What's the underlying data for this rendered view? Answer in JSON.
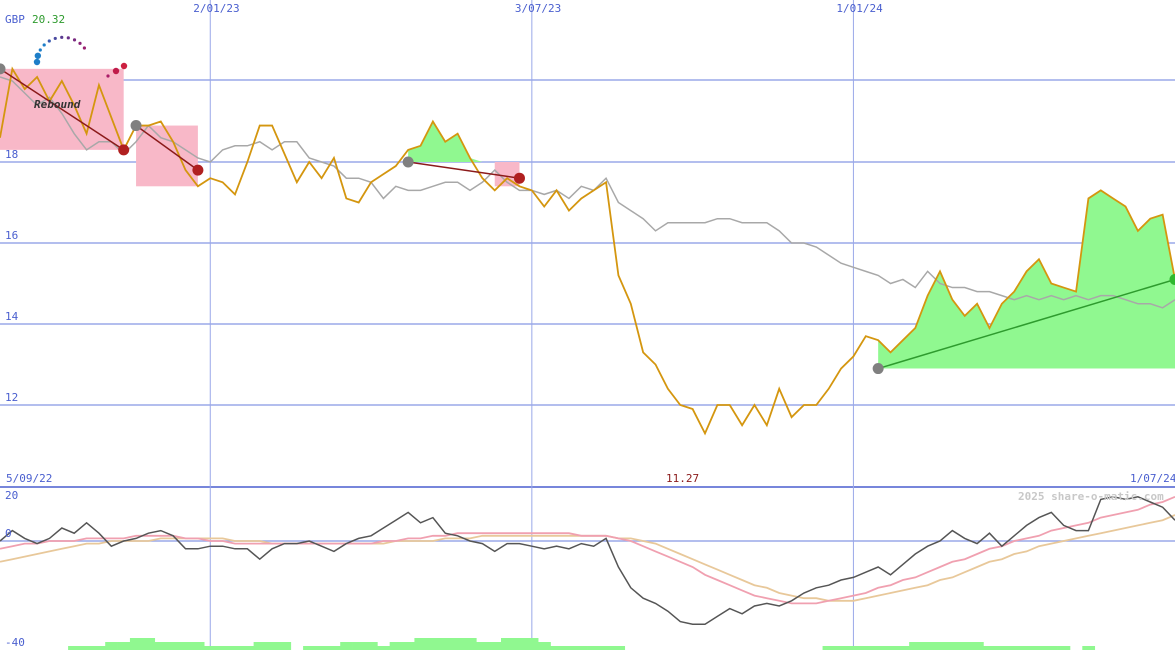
{
  "header": {
    "currency": "GBP",
    "last_price": "20.32",
    "start_date": "5/09/22",
    "end_date": "1/07/24",
    "min_label": "11.27",
    "watermark": "2025 share-o-matic.com",
    "logo_text": "Rebound"
  },
  "colors": {
    "price": "#d4960f",
    "index": "#a8a8a8",
    "grid": "#9aa8e8",
    "fill_up": "#90f890",
    "fill_down": "#f8b8c8",
    "trend_up": "#2e9b2e",
    "trend_down": "#8b1a1a",
    "osc": "#555555",
    "ma_fast": "#f0a0b0",
    "ma_slow": "#e8c89a",
    "volume": "#90f890"
  },
  "chart_data": [
    {
      "type": "line",
      "x_axis": {
        "type": "date",
        "start": "2022-09-05",
        "end": "2024-07-01",
        "ticks": [
          "2/01/23",
          "3/07/23",
          "1/01/24"
        ]
      },
      "y_axis": {
        "ticks": [
          12,
          14,
          16,
          18
        ],
        "range": [
          10.6,
          21.2
        ]
      },
      "grid": true,
      "series": [
        {
          "role": "price",
          "values": [
            18.6,
            20.3,
            19.8,
            20.1,
            19.5,
            20.0,
            19.4,
            18.7,
            19.9,
            19.1,
            18.3,
            18.9,
            18.9,
            19.0,
            18.5,
            17.8,
            17.4,
            17.6,
            17.5,
            17.2,
            18.0,
            18.9,
            18.9,
            18.2,
            17.5,
            18.0,
            17.6,
            18.1,
            17.1,
            17.0,
            17.5,
            17.7,
            17.9,
            18.3,
            18.4,
            19.0,
            18.5,
            18.7,
            18.1,
            17.6,
            17.3,
            17.6,
            17.4,
            17.3,
            16.9,
            17.3,
            16.8,
            17.1,
            17.3,
            17.5,
            15.2,
            14.5,
            13.3,
            13.0,
            12.4,
            12.0,
            11.9,
            11.3,
            12.0,
            12.0,
            11.5,
            12.0,
            11.5,
            12.4,
            11.7,
            12.0,
            12.0,
            12.4,
            12.9,
            13.2,
            13.7,
            13.6,
            13.3,
            13.6,
            13.9,
            14.7,
            15.3,
            14.6,
            14.2,
            14.5,
            13.9,
            14.5,
            14.8,
            15.3,
            15.6,
            15.0,
            14.9,
            14.8,
            17.1,
            17.3,
            17.1,
            16.9,
            16.3,
            16.6,
            16.7,
            15.1
          ]
        },
        {
          "role": "index",
          "values": [
            20.1,
            20.0,
            19.7,
            19.4,
            19.6,
            19.2,
            18.7,
            18.3,
            18.5,
            18.5,
            18.2,
            18.5,
            18.9,
            18.6,
            18.5,
            18.3,
            18.1,
            18.0,
            18.3,
            18.4,
            18.4,
            18.5,
            18.3,
            18.5,
            18.5,
            18.1,
            18.0,
            17.9,
            17.6,
            17.6,
            17.5,
            17.1,
            17.4,
            17.3,
            17.3,
            17.4,
            17.5,
            17.5,
            17.3,
            17.5,
            17.8,
            17.5,
            17.3,
            17.3,
            17.2,
            17.3,
            17.1,
            17.4,
            17.3,
            17.6,
            17.0,
            16.8,
            16.6,
            16.3,
            16.5,
            16.5,
            16.5,
            16.5,
            16.6,
            16.6,
            16.5,
            16.5,
            16.5,
            16.3,
            16.0,
            16.0,
            15.9,
            15.7,
            15.5,
            15.4,
            15.3,
            15.2,
            15.0,
            15.1,
            14.9,
            15.3,
            15.0,
            14.9,
            14.9,
            14.8,
            14.8,
            14.7,
            14.6,
            14.7,
            14.6,
            14.7,
            14.6,
            14.7,
            14.6,
            14.7,
            14.7,
            14.6,
            14.5,
            14.5,
            14.4,
            14.6
          ]
        }
      ],
      "signals": [
        {
          "direction": "down",
          "from": [
            0,
            20.3
          ],
          "to": [
            10,
            18.3
          ]
        },
        {
          "direction": "down",
          "from": [
            11,
            18.9
          ],
          "to": [
            16,
            17.8
          ]
        },
        {
          "direction": "down",
          "from": [
            33,
            18.0
          ],
          "to": [
            42,
            17.6
          ]
        },
        {
          "direction": "up",
          "from": [
            71,
            12.9
          ],
          "to": [
            95,
            15.1
          ]
        }
      ]
    },
    {
      "type": "line",
      "role": "oscillator",
      "y_axis": {
        "ticks": [
          20,
          0,
          -40
        ],
        "range": [
          -40,
          20
        ]
      },
      "series": [
        {
          "role": "oscillator",
          "values": [
            0,
            4,
            1,
            -1,
            1,
            5,
            3,
            7,
            3,
            -2,
            0,
            1,
            3,
            4,
            2,
            -3,
            -3,
            -2,
            -2,
            -3,
            -3,
            -7,
            -3,
            -1,
            -1,
            0,
            -2,
            -4,
            -1,
            1,
            2,
            5,
            8,
            11,
            7,
            9,
            3,
            2,
            0,
            -1,
            -4,
            -1,
            -1,
            -2,
            -3,
            -2,
            -3,
            -1,
            -2,
            1,
            -10,
            -18,
            -22,
            -24,
            -27,
            -31,
            -32,
            -32,
            -29,
            -26,
            -28,
            -25,
            -24,
            -25,
            -23,
            -20,
            -18,
            -17,
            -15,
            -14,
            -12,
            -10,
            -13,
            -9,
            -5,
            -2,
            0,
            4,
            1,
            -1,
            3,
            -2,
            2,
            6,
            9,
            11,
            6,
            4,
            4,
            16,
            17,
            16,
            17,
            15,
            13,
            8
          ]
        },
        {
          "role": "ma_fast",
          "values": [
            -3,
            -2,
            -1,
            -1,
            0,
            0,
            0,
            1,
            1,
            1,
            1,
            2,
            2,
            2,
            2,
            1,
            1,
            0,
            0,
            -1,
            -1,
            -1,
            -1,
            -1,
            -1,
            -1,
            -1,
            -1,
            -1,
            -1,
            -1,
            0,
            0,
            1,
            1,
            2,
            2,
            3,
            3,
            3,
            3,
            3,
            3,
            3,
            3,
            3,
            3,
            2,
            2,
            2,
            1,
            0,
            -2,
            -4,
            -6,
            -8,
            -10,
            -13,
            -15,
            -17,
            -19,
            -21,
            -22,
            -23,
            -24,
            -24,
            -24,
            -23,
            -22,
            -21,
            -20,
            -18,
            -17,
            -15,
            -14,
            -12,
            -10,
            -8,
            -7,
            -5,
            -3,
            -2,
            0,
            1,
            2,
            4,
            5,
            6,
            7,
            9,
            10,
            11,
            12,
            14,
            15,
            17
          ]
        },
        {
          "role": "ma_slow",
          "values": [
            -8,
            -7,
            -6,
            -5,
            -4,
            -3,
            -2,
            -1,
            -1,
            0,
            0,
            0,
            0,
            1,
            1,
            1,
            1,
            1,
            1,
            0,
            0,
            0,
            -1,
            -1,
            -1,
            -1,
            -1,
            -1,
            -1,
            -1,
            -1,
            -1,
            0,
            0,
            0,
            0,
            1,
            1,
            1,
            2,
            2,
            2,
            2,
            2,
            2,
            2,
            2,
            2,
            2,
            2,
            1,
            1,
            0,
            -1,
            -3,
            -5,
            -7,
            -9,
            -11,
            -13,
            -15,
            -17,
            -18,
            -20,
            -21,
            -22,
            -22,
            -23,
            -23,
            -23,
            -22,
            -21,
            -20,
            -19,
            -18,
            -17,
            -15,
            -14,
            -12,
            -10,
            -8,
            -7,
            -5,
            -4,
            -2,
            -1,
            0,
            1,
            2,
            3,
            4,
            5,
            6,
            7,
            8,
            10
          ]
        }
      ],
      "volume": [
        0,
        0,
        0,
        0,
        0,
        0,
        1,
        1,
        1,
        2,
        2,
        3,
        3,
        2,
        2,
        2,
        2,
        1,
        1,
        1,
        1,
        2,
        2,
        2,
        0,
        1,
        1,
        1,
        2,
        2,
        2,
        1,
        2,
        2,
        3,
        3,
        3,
        3,
        3,
        2,
        2,
        3,
        3,
        3,
        2,
        1,
        1,
        1,
        1,
        1,
        1,
        0,
        0,
        0,
        0,
        0,
        0,
        0,
        0,
        0,
        0,
        0,
        0,
        0,
        0,
        0,
        0,
        1,
        1,
        1,
        1,
        1,
        1,
        1,
        2,
        2,
        2,
        2,
        2,
        2,
        1,
        1,
        1,
        1,
        1,
        1,
        1,
        0,
        1,
        0,
        0,
        0,
        0,
        0,
        0,
        0
      ]
    }
  ]
}
